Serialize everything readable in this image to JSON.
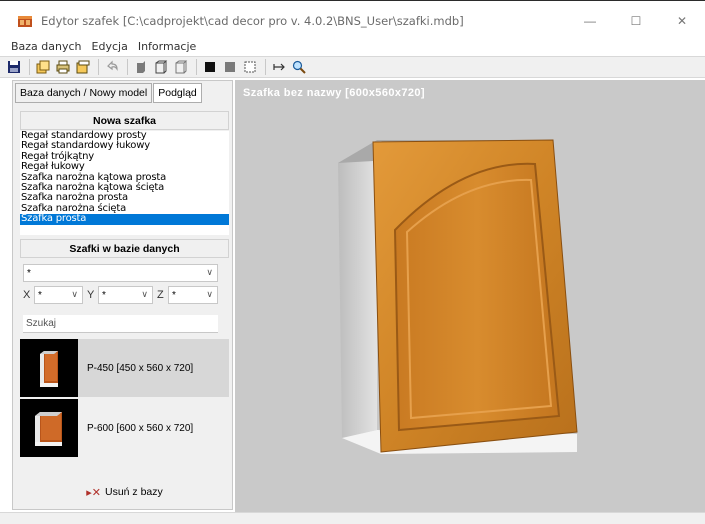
{
  "window": {
    "title": "Edytor szafek [C:\\cadprojekt\\cad decor pro v. 4.0.2\\BNS_User\\szafki.mdb]",
    "minimize": "—",
    "maximize": "☐",
    "close": "✕"
  },
  "menu": [
    "Baza danych",
    "Edycja",
    "Informacje"
  ],
  "toolbar": {
    "buttons": [
      "save-icon",
      "layers-icon",
      "print-icon",
      "copy-icon",
      "undo-icon",
      "cabinet-solid-icon",
      "cabinet-box-icon",
      "cabinet-outline-icon",
      "fill-black-icon",
      "fill-gray-icon",
      "frame-icon",
      "dimension-icon",
      "zoom-icon"
    ]
  },
  "tabs": {
    "database": "Baza danych / Nowy model",
    "preview": "Podgląd"
  },
  "new_cabinet": {
    "header": "Nowa szafka",
    "items": [
      "Regał standardowy prosty",
      "Regał standardowy łukowy",
      "Regał trójkątny",
      "Regał łukowy",
      "Szafka narożna kątowa prosta",
      "Szafka narożna kątowa ścięta",
      "Szafka narożna prosta",
      "Szafka narożna ścięta",
      "Szafka prosta"
    ],
    "selected": "Szafka prosta"
  },
  "database": {
    "header": "Szafki w bazie danych",
    "filter_value": "*",
    "x_label": "X",
    "x_value": "*",
    "y_label": "Y",
    "y_value": "*",
    "z_label": "Z",
    "z_value": "*",
    "search_placeholder": "Szukaj",
    "items": [
      {
        "label": "P-450  [450 x 560 x 720]"
      },
      {
        "label": "P-600  [600 x 560 x 720]"
      }
    ],
    "remove_label": "Usuń z bazy"
  },
  "viewport": {
    "title": "Szafka bez nazwy [600x560x720]"
  },
  "colors": {
    "selection": "#0078d7",
    "viewport_bg": "#c9c9c9",
    "door_wood": "#d38a2a",
    "remove_icon": "#b0302a"
  }
}
